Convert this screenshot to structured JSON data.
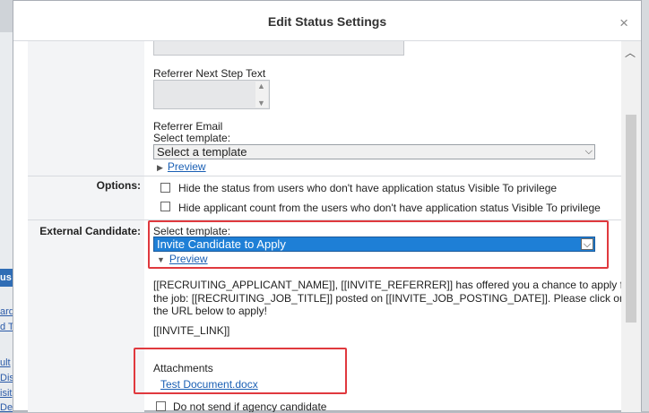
{
  "dialog": {
    "title": "Edit Status Settings",
    "close_glyph": "×"
  },
  "background": {
    "fragments": [
      "us",
      "arde",
      "d T",
      "ult",
      "Dis",
      "isit",
      "Def"
    ]
  },
  "form": {
    "referrer_next_step_label": "Referrer Next Step Text",
    "referrer_email_label": "Referrer Email",
    "select_template_label": "Select template:",
    "referrer_template_value": "Select a template",
    "preview_label": "Preview",
    "options_label": "Options:",
    "option_hide_status": "Hide the status from users who don't have application status Visible To privilege",
    "option_hide_count": "Hide applicant count from the users who don't have application status Visible To privilege",
    "external_candidate_label": "External Candidate:",
    "external_select_template_label": "Select template:",
    "external_template_value": "Invite Candidate to Apply",
    "external_preview_label": "Preview",
    "message_line1": "[[RECRUITING_APPLICANT_NAME]], [[INVITE_REFERRER]] has offered you a chance to apply for",
    "message_line2": "the job: [[RECRUITING_JOB_TITLE]] posted on [[INVITE_JOB_POSTING_DATE]]. Please click on",
    "message_line3": "the URL below to apply!",
    "message_link_token": "[[INVITE_LINK]]",
    "attachments_label": "Attachments",
    "attachment_file": "Test Document.docx",
    "do_not_send_label": "Do not send if agency candidate"
  },
  "colors": {
    "highlight_red": "#e0393e",
    "selected_blue": "#1e7fd6",
    "link_blue": "#1a5fb4"
  }
}
